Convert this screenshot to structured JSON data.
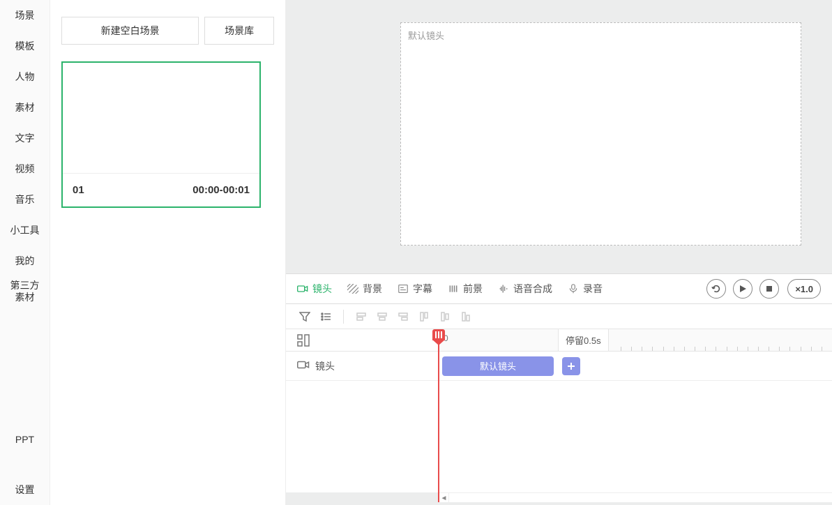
{
  "sidebar": {
    "items": [
      {
        "label": "场景"
      },
      {
        "label": "模板"
      },
      {
        "label": "人物"
      },
      {
        "label": "素材"
      },
      {
        "label": "文字"
      },
      {
        "label": "视频"
      },
      {
        "label": "音乐"
      },
      {
        "label": "小工具"
      },
      {
        "label": "我的"
      },
      {
        "label": "第三方\n素材"
      }
    ],
    "bottom": [
      {
        "label": "PPT"
      },
      {
        "label": "设置"
      }
    ]
  },
  "scene_panel": {
    "new_blank_label": "新建空白场景",
    "scene_library_label": "场景库",
    "card": {
      "index": "01",
      "timerange": "00:00-00:01"
    }
  },
  "canvas": {
    "default_shot_label": "默认镜头"
  },
  "timeline": {
    "tabs": [
      {
        "label": "镜头"
      },
      {
        "label": "背景"
      },
      {
        "label": "字幕"
      },
      {
        "label": "前景"
      },
      {
        "label": "语音合成"
      },
      {
        "label": "录音"
      }
    ],
    "speed_label": "×1.0",
    "ruler": {
      "zero_label": "0",
      "stay_label": "停留0.5s"
    },
    "track": {
      "label": "镜头",
      "clip_label": "默认镜头"
    }
  }
}
